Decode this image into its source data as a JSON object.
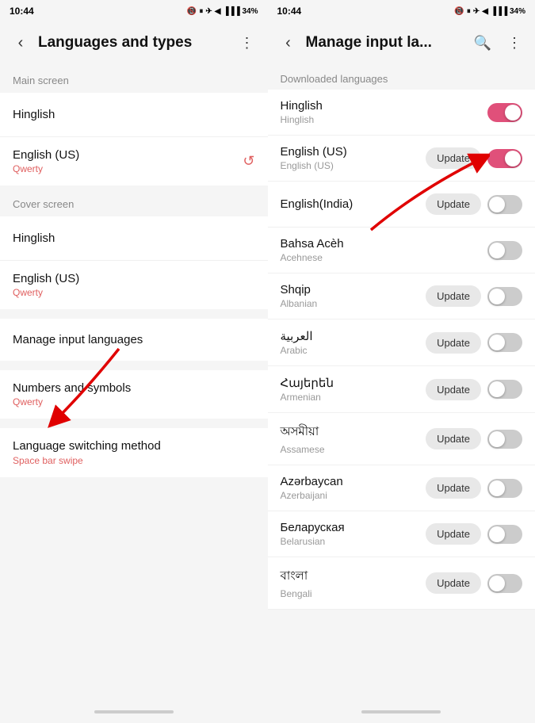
{
  "left_panel": {
    "status": {
      "time": "10:44",
      "icons": "📵 ⏸ ✈ ◀ •"
    },
    "header": {
      "title": "Languages and types",
      "back_label": "‹",
      "menu_label": "⋮"
    },
    "sections": [
      {
        "label": "Main screen",
        "items": [
          {
            "title": "Hinglish",
            "subtitle": "",
            "right": ""
          },
          {
            "title": "English (US)",
            "subtitle": "Qwerty",
            "right": "refresh"
          }
        ]
      },
      {
        "label": "Cover screen",
        "items": [
          {
            "title": "Hinglish",
            "subtitle": "",
            "right": ""
          },
          {
            "title": "English (US)",
            "subtitle": "Qwerty",
            "right": ""
          }
        ]
      }
    ],
    "manage_item": "Manage input languages",
    "numbers_item": {
      "title": "Numbers and symbols",
      "subtitle": "Qwerty"
    },
    "lang_switch_item": {
      "title": "Language switching method",
      "subtitle": "Space bar swipe"
    }
  },
  "right_panel": {
    "status": {
      "time": "10:44",
      "icons": "📵 ⏸ ✈ ◀ •"
    },
    "header": {
      "title": "Manage input la...",
      "back_label": "‹",
      "search_label": "🔍",
      "menu_label": "⋮"
    },
    "dl_section_label": "Downloaded languages",
    "languages": [
      {
        "name": "Hinglish",
        "sub": "Hinglish",
        "toggle": "on",
        "update": false
      },
      {
        "name": "English (US)",
        "sub": "English (US)",
        "toggle": "on",
        "update": true
      },
      {
        "name": "English(India)",
        "sub": "",
        "toggle": "off",
        "update": true
      },
      {
        "name": "Bahsa Acèh",
        "sub": "Acehnese",
        "toggle": "off",
        "update": false
      },
      {
        "name": "Shqip",
        "sub": "Albanian",
        "toggle": "off",
        "update": true
      },
      {
        "name": "العربية",
        "sub": "Arabic",
        "toggle": "off",
        "update": true
      },
      {
        "name": "Հայերեն",
        "sub": "Armenian",
        "toggle": "off",
        "update": true
      },
      {
        "name": "অসমীয়া",
        "sub": "Assamese",
        "toggle": "off",
        "update": true
      },
      {
        "name": "Azərbaycan",
        "sub": "Azerbaijani",
        "toggle": "off",
        "update": true
      },
      {
        "name": "Беларуская",
        "sub": "Belarusian",
        "toggle": "off",
        "update": true
      },
      {
        "name": "বাংলা",
        "sub": "Bengali",
        "toggle": "off",
        "update": true
      }
    ],
    "update_label": "Update"
  }
}
